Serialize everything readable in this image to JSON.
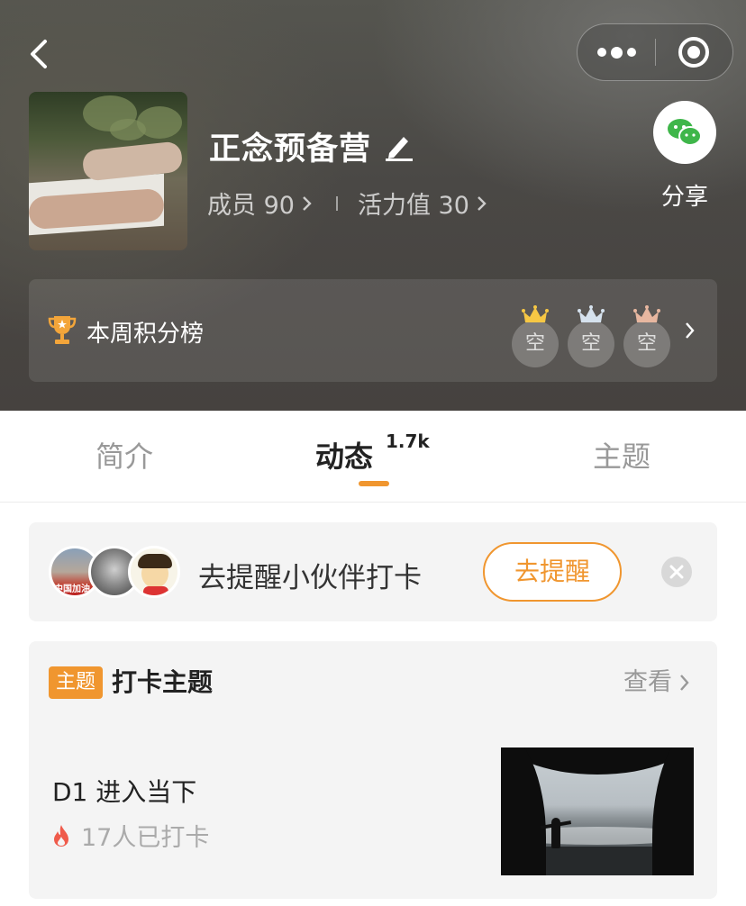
{
  "header": {
    "group_title": "正念预备营",
    "members_label": "成员",
    "members_count": "90",
    "vitality_label": "活力值",
    "vitality_value": "30",
    "share_label": "分享"
  },
  "ranking": {
    "label": "本周积分榜",
    "slots": [
      {
        "text": "空",
        "crown_color": "#f6c744"
      },
      {
        "text": "空",
        "crown_color": "#d6e2ee"
      },
      {
        "text": "空",
        "crown_color": "#e8b7a0"
      }
    ]
  },
  "tabs": [
    {
      "label": "简介",
      "active": false
    },
    {
      "label": "动态",
      "active": true,
      "badge": "1.7k"
    },
    {
      "label": "主题",
      "active": false
    }
  ],
  "reminder": {
    "avatar_caption": "中国加油",
    "text": "去提醒小伙伴打卡",
    "button_label": "去提醒"
  },
  "topic_card": {
    "tag": "主题",
    "title": "打卡主题",
    "view_label": "查看",
    "item_title": "D1 进入当下",
    "item_meta": "17人已打卡"
  },
  "colors": {
    "accent": "#f0962f",
    "fire": "#ef5b4b"
  }
}
